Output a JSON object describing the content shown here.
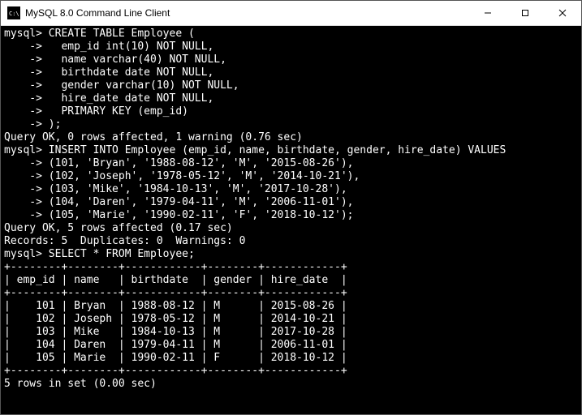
{
  "window": {
    "title": "MySQL 8.0 Command Line Client",
    "min": "—",
    "max": "☐",
    "close": "✕"
  },
  "terminal": {
    "lines": [
      "mysql> CREATE TABLE Employee (",
      "    ->   emp_id int(10) NOT NULL,",
      "    ->   name varchar(40) NOT NULL,",
      "    ->   birthdate date NOT NULL,",
      "    ->   gender varchar(10) NOT NULL,",
      "    ->   hire_date date NOT NULL,",
      "    ->   PRIMARY KEY (emp_id)",
      "    -> );",
      "Query OK, 0 rows affected, 1 warning (0.76 sec)",
      "",
      "mysql> INSERT INTO Employee (emp_id, name, birthdate, gender, hire_date) VALUES",
      "    -> (101, 'Bryan', '1988-08-12', 'M', '2015-08-26'),",
      "    -> (102, 'Joseph', '1978-05-12', 'M', '2014-10-21'),",
      "    -> (103, 'Mike', '1984-10-13', 'M', '2017-10-28'),",
      "    -> (104, 'Daren', '1979-04-11', 'M', '2006-11-01'),",
      "    -> (105, 'Marie', '1990-02-11', 'F', '2018-10-12');",
      "Query OK, 5 rows affected (0.17 sec)",
      "Records: 5  Duplicates: 0  Warnings: 0",
      "",
      "mysql> SELECT * FROM Employee;",
      "+--------+--------+------------+--------+------------+",
      "| emp_id | name   | birthdate  | gender | hire_date  |",
      "+--------+--------+------------+--------+------------+",
      "|    101 | Bryan  | 1988-08-12 | M      | 2015-08-26 |",
      "|    102 | Joseph | 1978-05-12 | M      | 2014-10-21 |",
      "|    103 | Mike   | 1984-10-13 | M      | 2017-10-28 |",
      "|    104 | Daren  | 1979-04-11 | M      | 2006-11-01 |",
      "|    105 | Marie  | 1990-02-11 | F      | 2018-10-12 |",
      "+--------+--------+------------+--------+------------+",
      "5 rows in set (0.00 sec)"
    ]
  }
}
